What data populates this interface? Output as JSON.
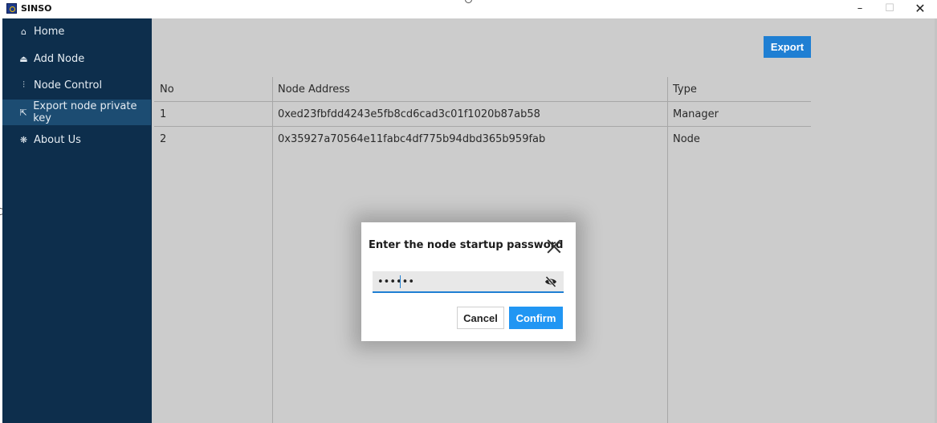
{
  "window": {
    "title": "SINSO",
    "minimize": "–",
    "maximize": "☐",
    "close": "✕"
  },
  "sidebar": {
    "items": [
      {
        "label": "Home",
        "icon": "home-icon",
        "glyph": "⌂"
      },
      {
        "label": "Add Node",
        "icon": "add-node-icon",
        "glyph": "⏏"
      },
      {
        "label": "Node Control",
        "icon": "sliders-icon",
        "glyph": "⫶"
      },
      {
        "label": "Export node private key",
        "icon": "export-icon",
        "glyph": "⇱",
        "active": true
      },
      {
        "label": "About Us",
        "icon": "about-icon",
        "glyph": "❋"
      }
    ]
  },
  "toolbar": {
    "export_label": "Export"
  },
  "table": {
    "headers": [
      "No",
      "Node Address",
      "Type"
    ],
    "rows": [
      [
        "1",
        "0xed23fbfdd4243e5fb8cd6cad3c01f1020b87ab58",
        "Manager"
      ],
      [
        "2",
        "0x35927a70564e11fabc4df775b94dbd365b959fab",
        "Node"
      ]
    ]
  },
  "dialog": {
    "title": "Enter the node startup password",
    "password_value": "••••••",
    "cancel_label": "Cancel",
    "confirm_label": "Confirm"
  },
  "colors": {
    "sidebar_bg": "#0d2e4c",
    "sidebar_active": "#1c4c72",
    "accent": "#2196f3",
    "main_bg": "#cccccc"
  }
}
